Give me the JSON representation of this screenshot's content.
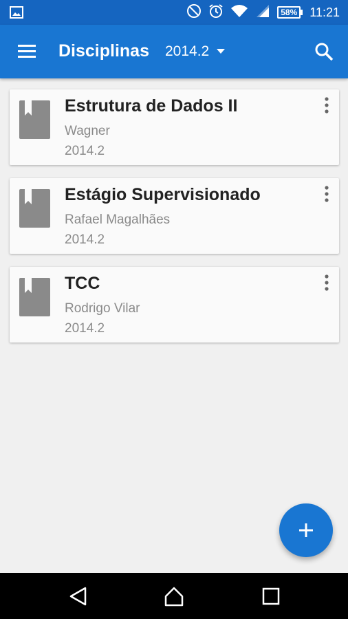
{
  "status_bar": {
    "time": "11:21",
    "battery": "58%",
    "icons": [
      "image-notification-icon",
      "do-not-disturb-icon",
      "alarm-icon",
      "wifi-icon",
      "signal-icon",
      "battery-icon"
    ]
  },
  "app_bar": {
    "title": "Disciplinas",
    "semester": "2014.2",
    "icons": [
      "menu-icon",
      "dropdown-arrow-icon",
      "search-icon"
    ]
  },
  "courses": [
    {
      "title": "Estrutura de Dados II",
      "teacher": "Wagner",
      "semester": "2014.2"
    },
    {
      "title": "Estágio Supervisionado",
      "teacher": "Rafael Magalhães",
      "semester": "2014.2"
    },
    {
      "title": "TCC",
      "teacher": "Rodrigo Vilar",
      "semester": "2014.2"
    }
  ],
  "fab": {
    "icon": "add-icon"
  },
  "nav_bar": {
    "icons": [
      "back-icon",
      "home-icon",
      "recents-icon"
    ]
  },
  "colors": {
    "primary": "#1976d2",
    "primary_dark": "#1565c0",
    "background": "#f0f0f0",
    "card": "#fafafa",
    "icon_gray": "#8a8a8a"
  }
}
